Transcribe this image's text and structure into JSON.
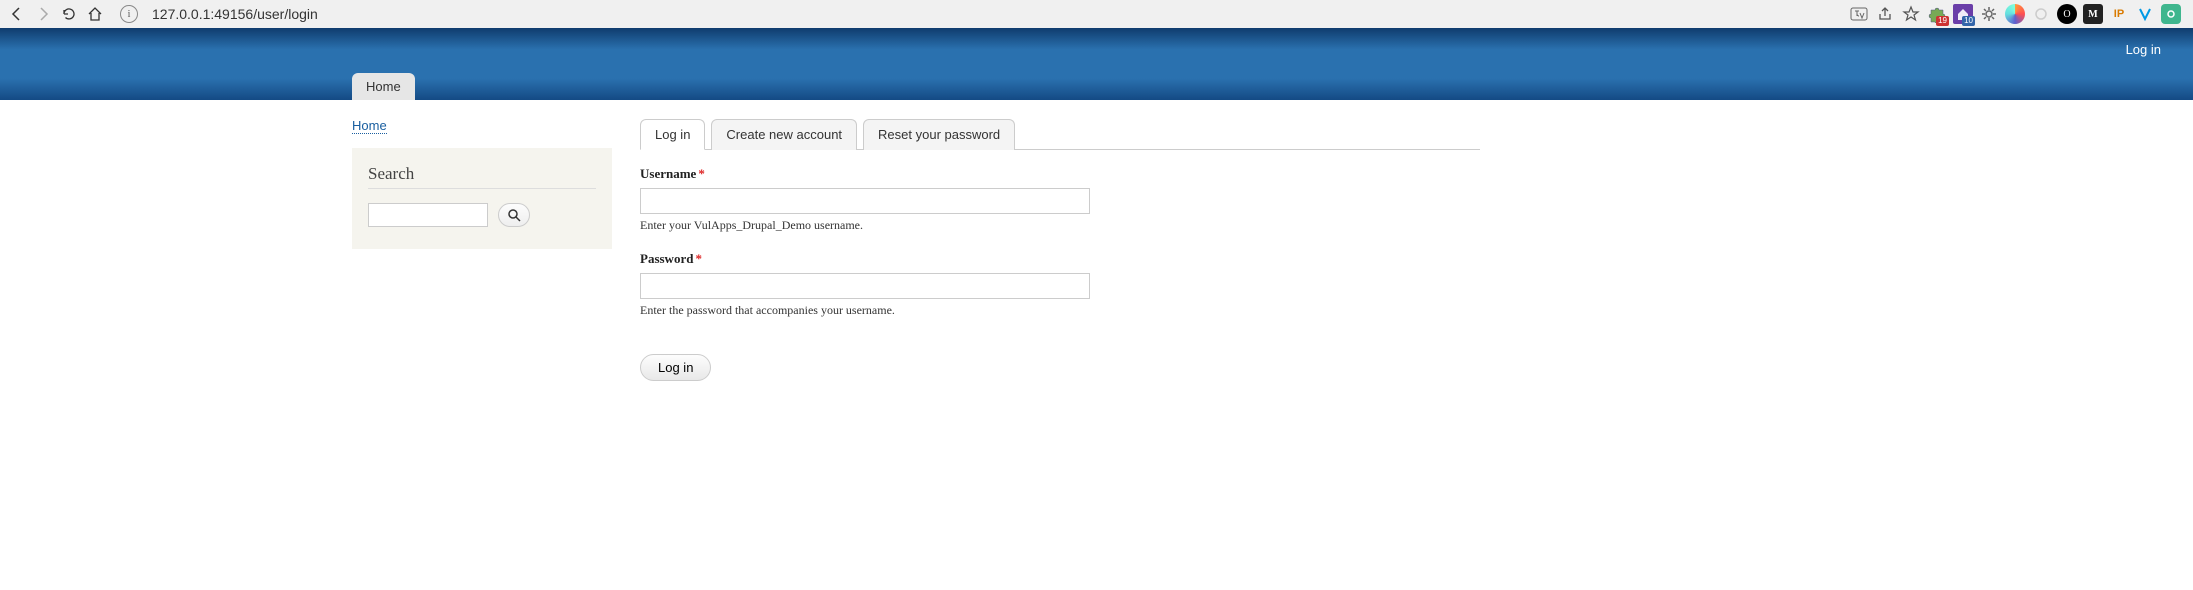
{
  "browser": {
    "url": "127.0.0.1:49156/user/login",
    "back": "←",
    "forward": "→",
    "reload": "↻",
    "home_nav": "⌂",
    "info": "i",
    "translate": "⠿",
    "share": "⇧",
    "star": "☆",
    "ext_puzzle_badge": "19",
    "ext_purple_badge": "10",
    "ext_dark_square": "M",
    "ext_ip": "IP",
    "ext_black_inner": "O"
  },
  "header": {
    "login_link": "Log in",
    "home_tab": "Home"
  },
  "breadcrumb": {
    "home": "Home"
  },
  "search": {
    "title": "Search",
    "icon": "🔍"
  },
  "tabs": {
    "login": "Log in",
    "create": "Create new account",
    "reset": "Reset your password"
  },
  "form": {
    "username_label": "Username",
    "username_hint": "Enter your VulApps_Drupal_Demo username.",
    "password_label": "Password",
    "password_hint": "Enter the password that accompanies your username.",
    "submit": "Log in"
  }
}
